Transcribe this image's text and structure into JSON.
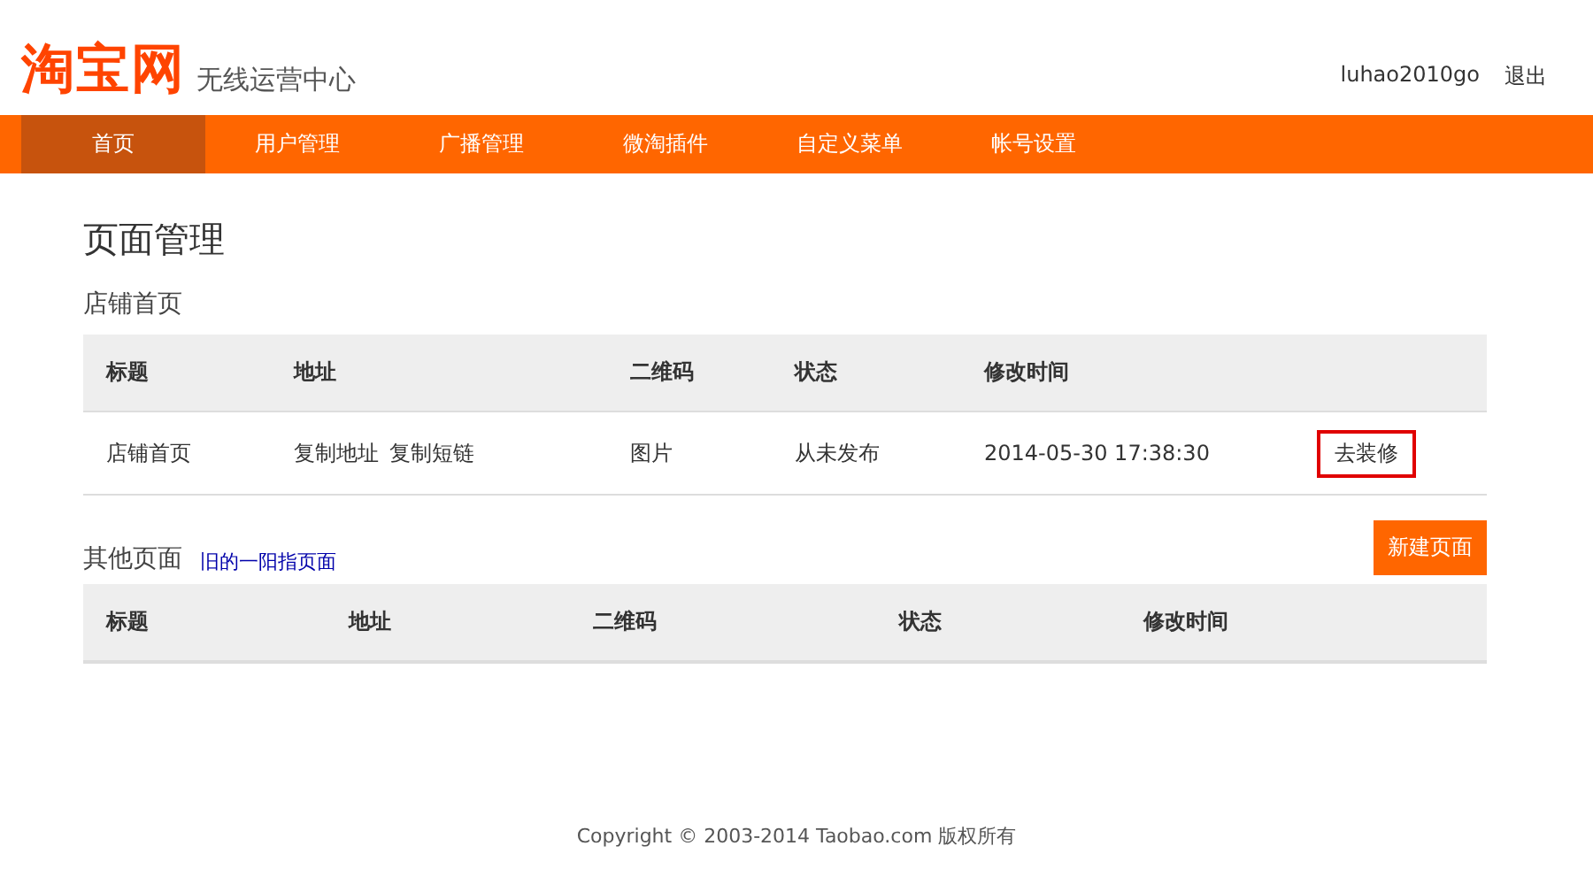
{
  "header": {
    "logo": "淘宝网",
    "subtitle": "无线运营中心",
    "user": "luhao2010go",
    "logout": "退出"
  },
  "nav": [
    {
      "label": "首页",
      "selected": true
    },
    {
      "label": "用户管理",
      "selected": false
    },
    {
      "label": "广播管理",
      "selected": false
    },
    {
      "label": "微淘插件",
      "selected": false
    },
    {
      "label": "自定义菜单",
      "selected": false
    },
    {
      "label": "帐号设置",
      "selected": false
    }
  ],
  "page_title": "页面管理",
  "shop_section": {
    "title": "店铺首页",
    "columns": [
      "标题",
      "地址",
      "二维码",
      "状态",
      "修改时间"
    ],
    "rows": [
      {
        "title": "店铺首页",
        "links": [
          "复制地址",
          "复制短链"
        ],
        "qrcode": "图片",
        "status": "从未发布",
        "modified": "2014-05-30 17:38:30",
        "action": "去装修"
      }
    ]
  },
  "other_section": {
    "title": "其他页面",
    "link": "旧的一阳指页面",
    "new_button": "新建页面",
    "columns": [
      "标题",
      "地址",
      "二维码",
      "状态",
      "修改时间"
    ]
  },
  "footer": "Copyright © 2003-2014 Taobao.com 版权所有"
}
